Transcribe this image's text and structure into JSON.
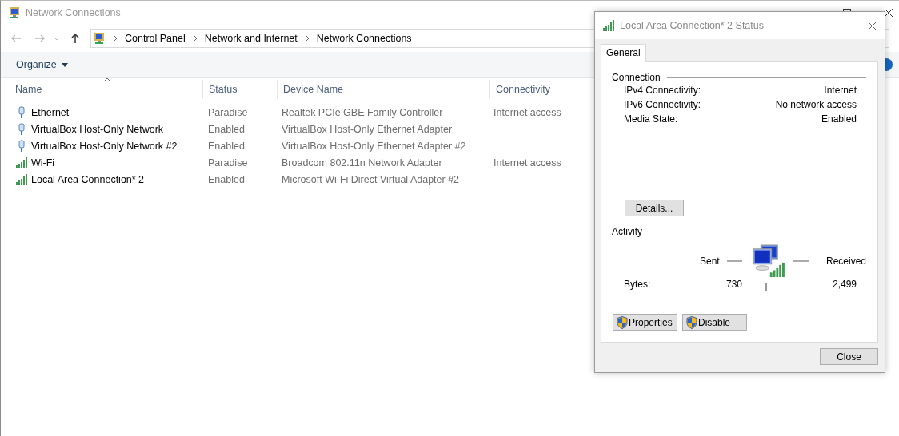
{
  "window": {
    "title": "Network Connections"
  },
  "address_bar": {
    "path": [
      "Control Panel",
      "Network and Internet",
      "Network Connections"
    ]
  },
  "toolbar": {
    "organize": "Organize"
  },
  "table": {
    "columns": [
      "Name",
      "Status",
      "Device Name",
      "Connectivity"
    ],
    "rows": [
      {
        "kind": "ethernet",
        "name": "Ethernet",
        "status": "Paradise",
        "device": "Realtek PCIe GBE Family Controller",
        "connectivity": "Internet access"
      },
      {
        "kind": "ethernet",
        "name": "VirtualBox Host-Only Network",
        "status": "Enabled",
        "device": "VirtualBox Host-Only Ethernet Adapter",
        "connectivity": ""
      },
      {
        "kind": "ethernet",
        "name": "VirtualBox Host-Only Network #2",
        "status": "Enabled",
        "device": "VirtualBox Host-Only Ethernet Adapter #2",
        "connectivity": ""
      },
      {
        "kind": "wifi",
        "name": "Wi-Fi",
        "status": "Paradise",
        "device": "Broadcom 802.11n Network Adapter",
        "connectivity": "Internet access"
      },
      {
        "kind": "wifi",
        "name": "Local Area Connection* 2",
        "status": "Enabled",
        "device": "Microsoft Wi-Fi Direct Virtual Adapter #2",
        "connectivity": ""
      }
    ]
  },
  "dialog": {
    "title": "Local Area Connection* 2 Status",
    "tabs": [
      {
        "label": "General",
        "selected": true
      }
    ],
    "connection": {
      "heading": "Connection",
      "fields": [
        {
          "label": "IPv4 Connectivity:",
          "value": "Internet"
        },
        {
          "label": "IPv6 Connectivity:",
          "value": "No network access"
        },
        {
          "label": "Media State:",
          "value": "Enabled"
        }
      ]
    },
    "details_button": "Details...",
    "activity": {
      "heading": "Activity",
      "sent_label": "Sent",
      "received_label": "Received",
      "bytes_label": "Bytes:",
      "sent": "730",
      "received": "2,499"
    },
    "buttons": [
      "Properties",
      "Disable"
    ],
    "close_button": "Close"
  }
}
